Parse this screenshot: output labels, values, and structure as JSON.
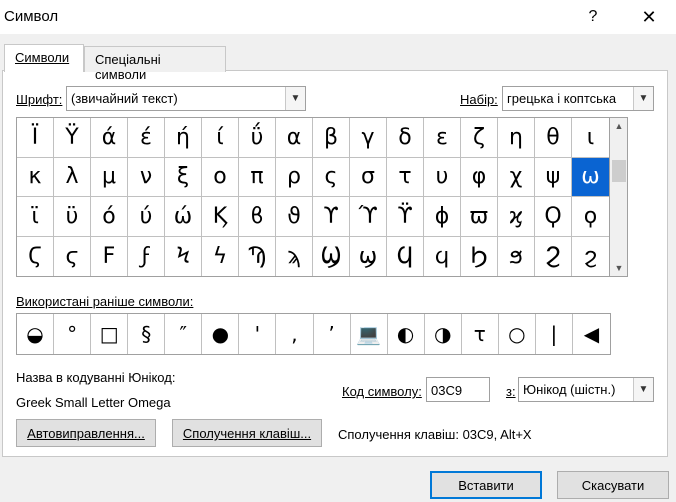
{
  "window": {
    "title": "Символ",
    "help": "?",
    "close": "✕"
  },
  "tabs": [
    {
      "label": "Символи",
      "active": true
    },
    {
      "label": "Спеціальні символи",
      "active": false
    }
  ],
  "font": {
    "label": "Шрифт:",
    "value": "(звичайний текст)"
  },
  "subset": {
    "label": "Набір:",
    "value": "грецька і коптська"
  },
  "grid": {
    "chars": [
      "Ϊ",
      "Ϋ",
      "ά",
      "έ",
      "ή",
      "ί",
      "ΰ",
      "α",
      "β",
      "γ",
      "δ",
      "ε",
      "ζ",
      "η",
      "θ",
      "ι",
      "κ",
      "λ",
      "μ",
      "ν",
      "ξ",
      "ο",
      "π",
      "ρ",
      "ς",
      "σ",
      "τ",
      "υ",
      "φ",
      "χ",
      "ψ",
      "ω",
      "ϊ",
      "ϋ",
      "ό",
      "ύ",
      "ώ",
      "Ϗ",
      "ϐ",
      "ϑ",
      "ϒ",
      "ϓ",
      "ϔ",
      "ϕ",
      "ϖ",
      "ϗ",
      "Ϙ",
      "ϙ",
      "Ϛ",
      "ϛ",
      "Ϝ",
      "ϝ",
      "Ϟ",
      "ϟ",
      "Ϡ",
      "ϡ",
      "Ϣ",
      "ϣ",
      "Ϥ",
      "ϥ",
      "Ϧ",
      "ϧ",
      "Ϩ",
      "ϩ"
    ],
    "selected_index": 31
  },
  "recent": {
    "label": "Використані раніше символи:",
    "chars": [
      "◒",
      "°",
      "□",
      "§",
      "″",
      "●",
      "'",
      ",",
      "’",
      "💻",
      "◐",
      "◑",
      "τ",
      "○",
      "|",
      "◀"
    ]
  },
  "unicode_name": {
    "label": "Назва в кодуванні Юнікод:",
    "value": "Greek Small Letter Omega"
  },
  "char_code": {
    "label": "Код символу:",
    "value": "03C9"
  },
  "from": {
    "label": "з:",
    "value": "Юнікод (шістн.)"
  },
  "buttons": {
    "autocorrect": "Автовиправлення...",
    "shortcut_key": "Сполучення клавіш...",
    "insert": "Вставити",
    "cancel": "Скасувати"
  },
  "shortcut_text": "Сполучення клавіш: 03C9, Alt+X"
}
